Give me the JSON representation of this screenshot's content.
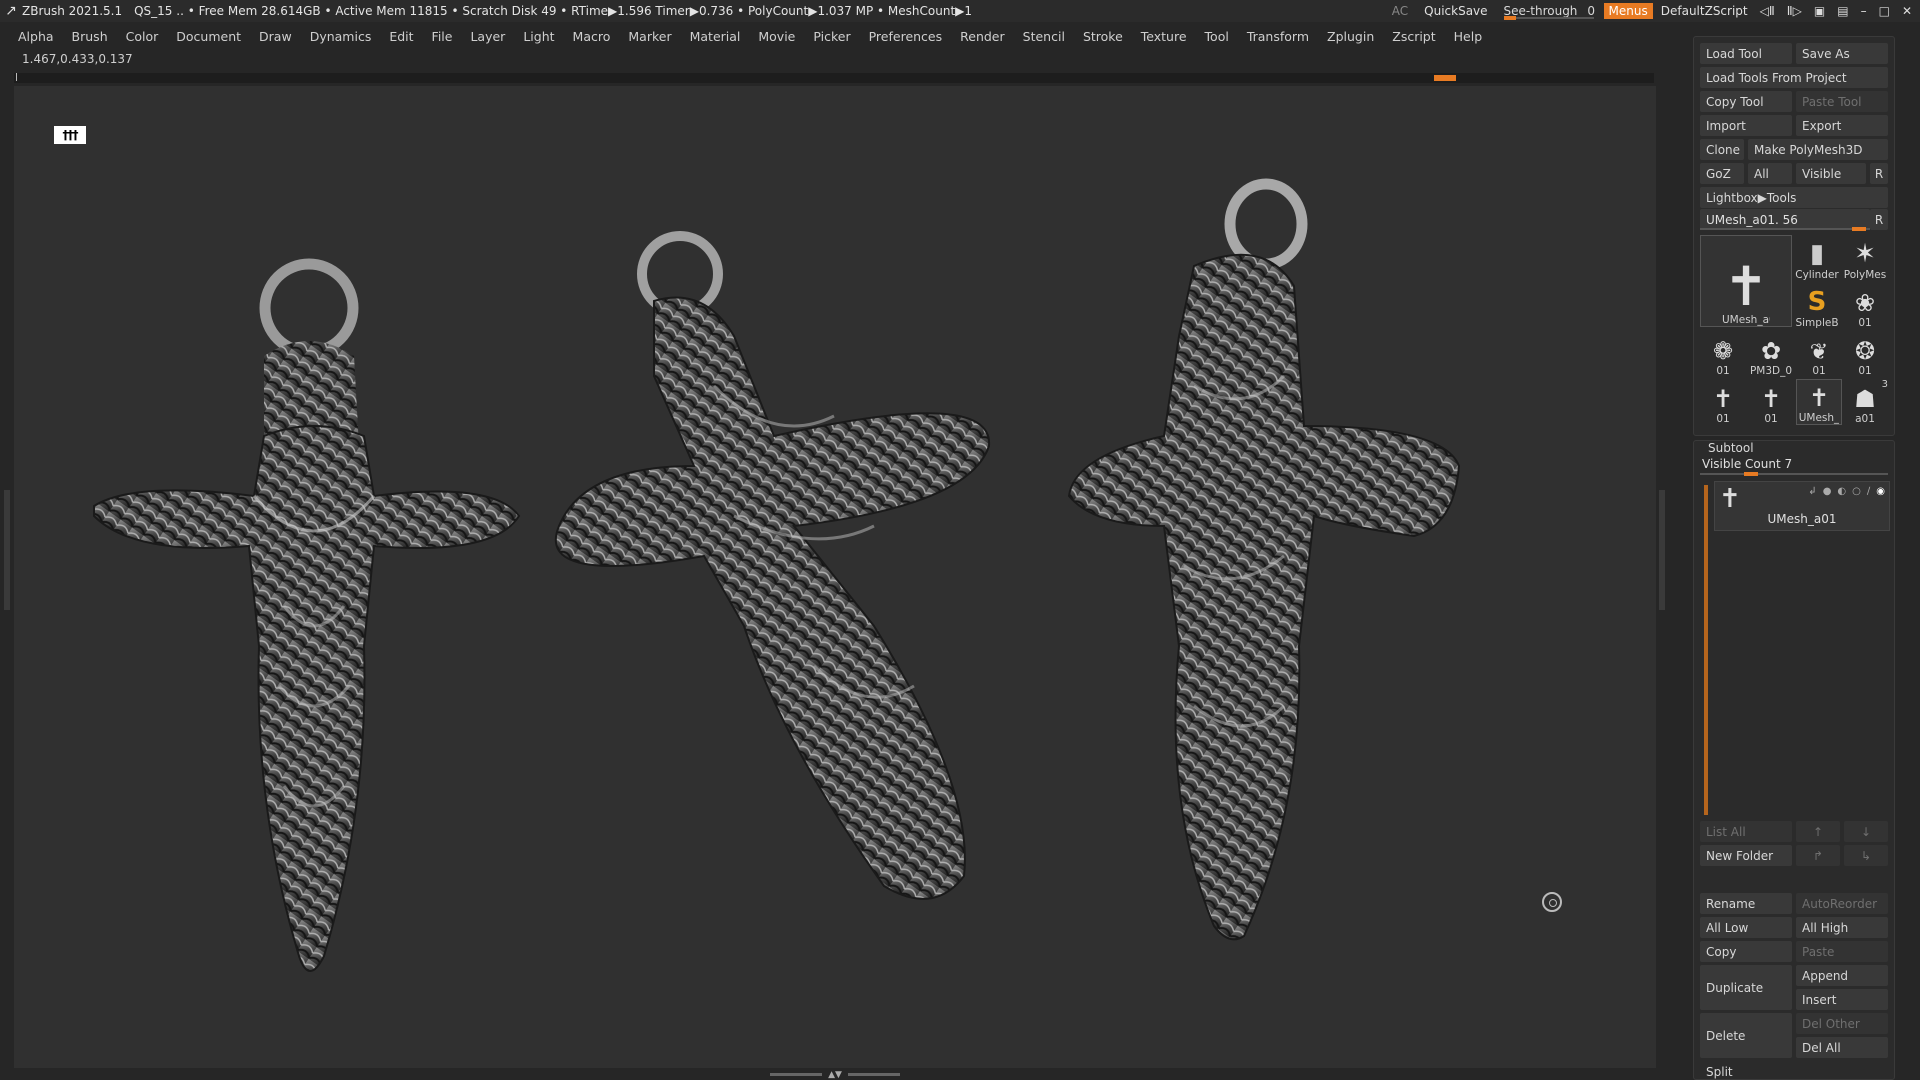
{
  "titlebar": {
    "app": "ZBrush 2021.5.1",
    "status": "QS_15   .. • Free Mem 28.614GB • Active Mem 11815 • Scratch Disk 49 •  RTime▶1.596 Timer▶0.736 • PolyCount▶1.037 MP  • MeshCount▶1",
    "ac": "AC",
    "quicksave": "QuickSave",
    "seethrough": "See-through",
    "seethrough_value": "0",
    "seethrough_level": 0,
    "menus": "Menus",
    "script": "DefaultZScript"
  },
  "menu_items": [
    "Alpha",
    "Brush",
    "Color",
    "Document",
    "Draw",
    "Dynamics",
    "Edit",
    "File",
    "Layer",
    "Light",
    "Macro",
    "Marker",
    "Material",
    "Movie",
    "Picker",
    "Preferences",
    "Render",
    "Stencil",
    "Stroke",
    "Texture",
    "Tool",
    "Transform",
    "Zplugin",
    "Zscript",
    "Help"
  ],
  "coords": "1.467,0.433,0.137",
  "tool_panel": {
    "load_tool": "Load Tool",
    "save_as": "Save As",
    "load_from_project": "Load Tools From Project",
    "copy_tool": "Copy Tool",
    "paste_tool": "Paste Tool",
    "import": "Import",
    "export": "Export",
    "clone": "Clone",
    "make_polymesh": "Make PolyMesh3D",
    "goz": "GoZ",
    "all": "All",
    "visible": "Visible",
    "r": "R",
    "lightbox": "Lightbox▶Tools",
    "current_tool": "UMesh_a01. 56",
    "r2": "R",
    "thumbs": {
      "main": "UMesh_a01",
      "cylinder": "Cylinder",
      "polymesh": "PolyMes",
      "simpleb": "SimpleB",
      "t01a": "01",
      "t01b": "01",
      "pm3d": "PM3D_0",
      "t01c": "01",
      "t01d": "01",
      "t01e": "01",
      "t01f": "01",
      "umesh2": "UMesh_",
      "a01": "a01",
      "three": "3"
    }
  },
  "subtool_panel": {
    "title": "Subtool",
    "visible_count": "Visible Count 7",
    "item_name": "UMesh_a01",
    "list_all": "List All",
    "new_folder": "New Folder",
    "rename": "Rename",
    "autoreorder": "AutoReorder",
    "all_low": "All Low",
    "all_high": "All High",
    "copy": "Copy",
    "paste": "Paste",
    "duplicate": "Duplicate",
    "append": "Append",
    "insert": "Insert",
    "delete": "Delete",
    "del_other": "Del Other",
    "del_all": "Del All",
    "split": "Split"
  }
}
